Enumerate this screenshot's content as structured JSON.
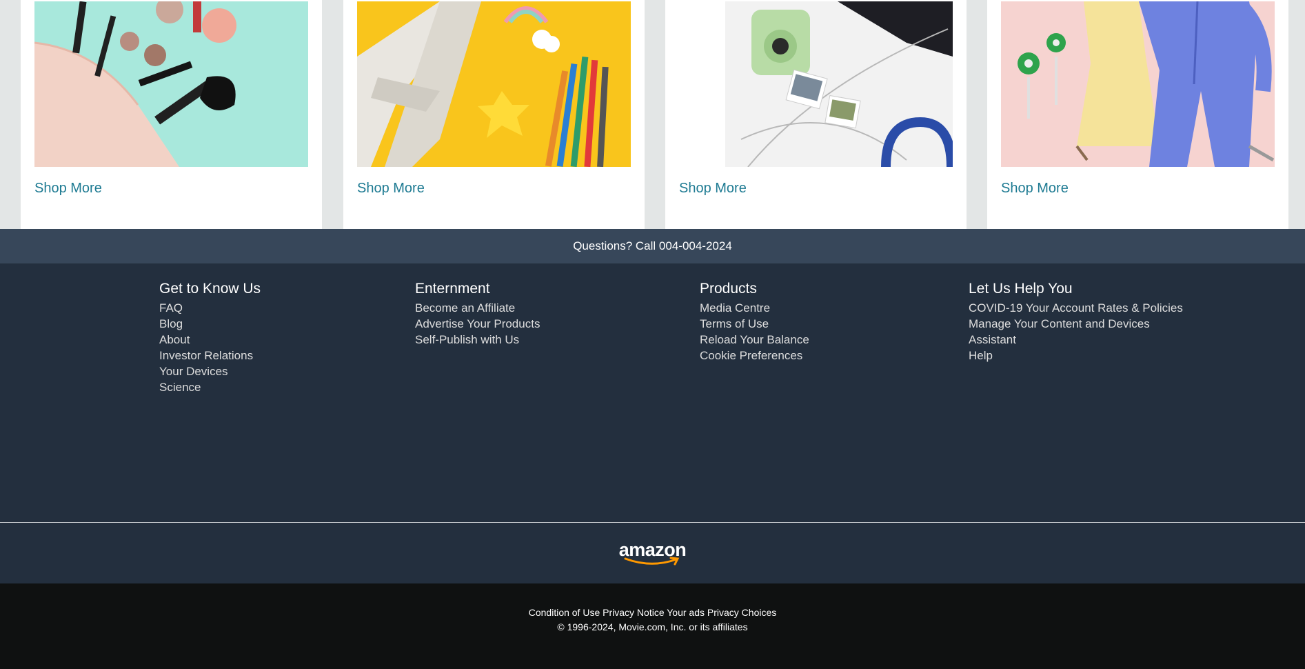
{
  "cards": [
    {
      "shop_label": "Shop More",
      "image": "makeup-bag-image"
    },
    {
      "shop_label": "Shop More",
      "image": "toys-pencils-image"
    },
    {
      "shop_label": "Shop More",
      "image": "camera-headphones-image"
    },
    {
      "shop_label": "Shop More",
      "image": "fashion-dresses-image"
    }
  ],
  "questions": "Questions? Call 004-004-2024",
  "footer_columns": [
    {
      "title": "Get to Know Us",
      "links": [
        "FAQ",
        "Blog",
        "About",
        "Investor Relations",
        "Your Devices",
        "Science"
      ]
    },
    {
      "title": "Enternment",
      "links": [
        "Become an Affiliate",
        "Advertise Your Products",
        "Self-Publish with Us"
      ]
    },
    {
      "title": "Products",
      "links": [
        "Media Centre",
        "Terms of Use",
        "Reload Your Balance",
        "Cookie Preferences"
      ]
    },
    {
      "title": "Let Us Help You",
      "links": [
        "COVID-19 Your Account Rates & Policies",
        "Manage Your Content and Devices",
        "Assistant",
        "Help"
      ]
    }
  ],
  "logo_text": "amazon",
  "bottom_links": [
    "Condition of Use",
    "Privacy Notice",
    "Your ads Privacy Choices"
  ],
  "copyright": "© 1996-2024, Movie.com, Inc. or its affiliates",
  "colors": {
    "accent_link": "#1d7a92",
    "footer_bg": "#232f3e",
    "questions_bg": "#37475a",
    "bottom_bg": "#0f1111",
    "logo_smile": "#ff9900"
  }
}
